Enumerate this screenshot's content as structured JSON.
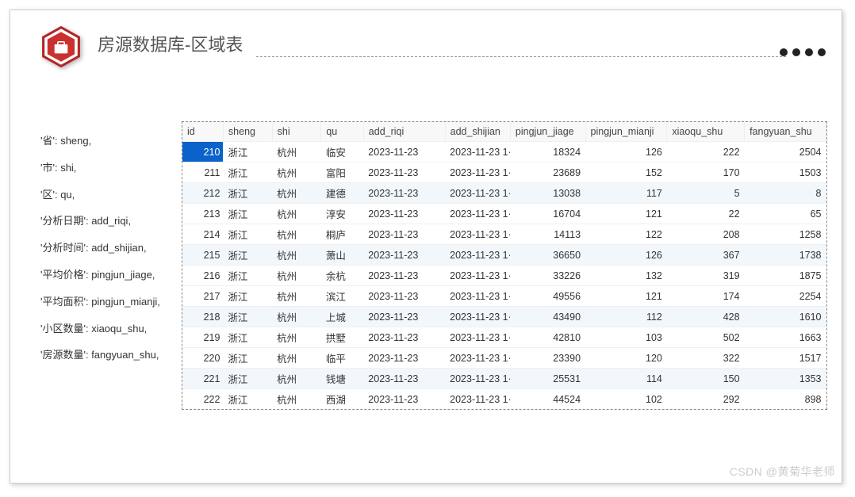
{
  "header": {
    "title": "房源数据库-区域表"
  },
  "legend": [
    "'省': sheng,",
    "'市': shi,",
    "'区': qu,",
    "'分析日期': add_riqi,",
    "'分析时间': add_shijian,",
    "'平均价格': pingjun_jiage,",
    "'平均面积': pingjun_mianji,",
    "'小区数量': xiaoqu_shu,",
    "'房源数量': fangyuan_shu,"
  ],
  "table": {
    "headers": [
      "id",
      "sheng",
      "shi",
      "qu",
      "add_riqi",
      "add_shijian",
      "pingjun_jiage",
      "pingjun_mianji",
      "xiaoqu_shu",
      "fangyuan_shu"
    ],
    "rows": [
      {
        "id": 210,
        "sheng": "浙江",
        "shi": "杭州",
        "qu": "临安",
        "add_riqi": "2023-11-23",
        "add_shijian": "2023-11-23 1·",
        "pingjun_jiage": 18324,
        "pingjun_mianji": 126,
        "xiaoqu_shu": 222,
        "fangyuan_shu": 2504,
        "selected": true,
        "alt": false
      },
      {
        "id": 211,
        "sheng": "浙江",
        "shi": "杭州",
        "qu": "富阳",
        "add_riqi": "2023-11-23",
        "add_shijian": "2023-11-23 1·",
        "pingjun_jiage": 23689,
        "pingjun_mianji": 152,
        "xiaoqu_shu": 170,
        "fangyuan_shu": 1503,
        "alt": false
      },
      {
        "id": 212,
        "sheng": "浙江",
        "shi": "杭州",
        "qu": "建德",
        "add_riqi": "2023-11-23",
        "add_shijian": "2023-11-23 1·",
        "pingjun_jiage": 13038,
        "pingjun_mianji": 117,
        "xiaoqu_shu": 5,
        "fangyuan_shu": 8,
        "alt": true
      },
      {
        "id": 213,
        "sheng": "浙江",
        "shi": "杭州",
        "qu": "淳安",
        "add_riqi": "2023-11-23",
        "add_shijian": "2023-11-23 1·",
        "pingjun_jiage": 16704,
        "pingjun_mianji": 121,
        "xiaoqu_shu": 22,
        "fangyuan_shu": 65,
        "alt": false
      },
      {
        "id": 214,
        "sheng": "浙江",
        "shi": "杭州",
        "qu": "桐庐",
        "add_riqi": "2023-11-23",
        "add_shijian": "2023-11-23 1·",
        "pingjun_jiage": 14113,
        "pingjun_mianji": 122,
        "xiaoqu_shu": 208,
        "fangyuan_shu": 1258,
        "alt": false
      },
      {
        "id": 215,
        "sheng": "浙江",
        "shi": "杭州",
        "qu": "萧山",
        "add_riqi": "2023-11-23",
        "add_shijian": "2023-11-23 1·",
        "pingjun_jiage": 36650,
        "pingjun_mianji": 126,
        "xiaoqu_shu": 367,
        "fangyuan_shu": 1738,
        "alt": true
      },
      {
        "id": 216,
        "sheng": "浙江",
        "shi": "杭州",
        "qu": "余杭",
        "add_riqi": "2023-11-23",
        "add_shijian": "2023-11-23 1·",
        "pingjun_jiage": 33226,
        "pingjun_mianji": 132,
        "xiaoqu_shu": 319,
        "fangyuan_shu": 1875,
        "alt": false
      },
      {
        "id": 217,
        "sheng": "浙江",
        "shi": "杭州",
        "qu": "滨江",
        "add_riqi": "2023-11-23",
        "add_shijian": "2023-11-23 1·",
        "pingjun_jiage": 49556,
        "pingjun_mianji": 121,
        "xiaoqu_shu": 174,
        "fangyuan_shu": 2254,
        "alt": false
      },
      {
        "id": 218,
        "sheng": "浙江",
        "shi": "杭州",
        "qu": "上城",
        "add_riqi": "2023-11-23",
        "add_shijian": "2023-11-23 1·",
        "pingjun_jiage": 43490,
        "pingjun_mianji": 112,
        "xiaoqu_shu": 428,
        "fangyuan_shu": 1610,
        "alt": true
      },
      {
        "id": 219,
        "sheng": "浙江",
        "shi": "杭州",
        "qu": "拱墅",
        "add_riqi": "2023-11-23",
        "add_shijian": "2023-11-23 1·",
        "pingjun_jiage": 42810,
        "pingjun_mianji": 103,
        "xiaoqu_shu": 502,
        "fangyuan_shu": 1663,
        "alt": false
      },
      {
        "id": 220,
        "sheng": "浙江",
        "shi": "杭州",
        "qu": "临平",
        "add_riqi": "2023-11-23",
        "add_shijian": "2023-11-23 1·",
        "pingjun_jiage": 23390,
        "pingjun_mianji": 120,
        "xiaoqu_shu": 322,
        "fangyuan_shu": 1517,
        "alt": false
      },
      {
        "id": 221,
        "sheng": "浙江",
        "shi": "杭州",
        "qu": "钱塘",
        "add_riqi": "2023-11-23",
        "add_shijian": "2023-11-23 1·",
        "pingjun_jiage": 25531,
        "pingjun_mianji": 114,
        "xiaoqu_shu": 150,
        "fangyuan_shu": 1353,
        "alt": true
      },
      {
        "id": 222,
        "sheng": "浙江",
        "shi": "杭州",
        "qu": "西湖",
        "add_riqi": "2023-11-23",
        "add_shijian": "2023-11-23 1·",
        "pingjun_jiage": 44524,
        "pingjun_mianji": 102,
        "xiaoqu_shu": 292,
        "fangyuan_shu": 898,
        "alt": false
      }
    ]
  },
  "watermark": "CSDN @黄菊华老师"
}
